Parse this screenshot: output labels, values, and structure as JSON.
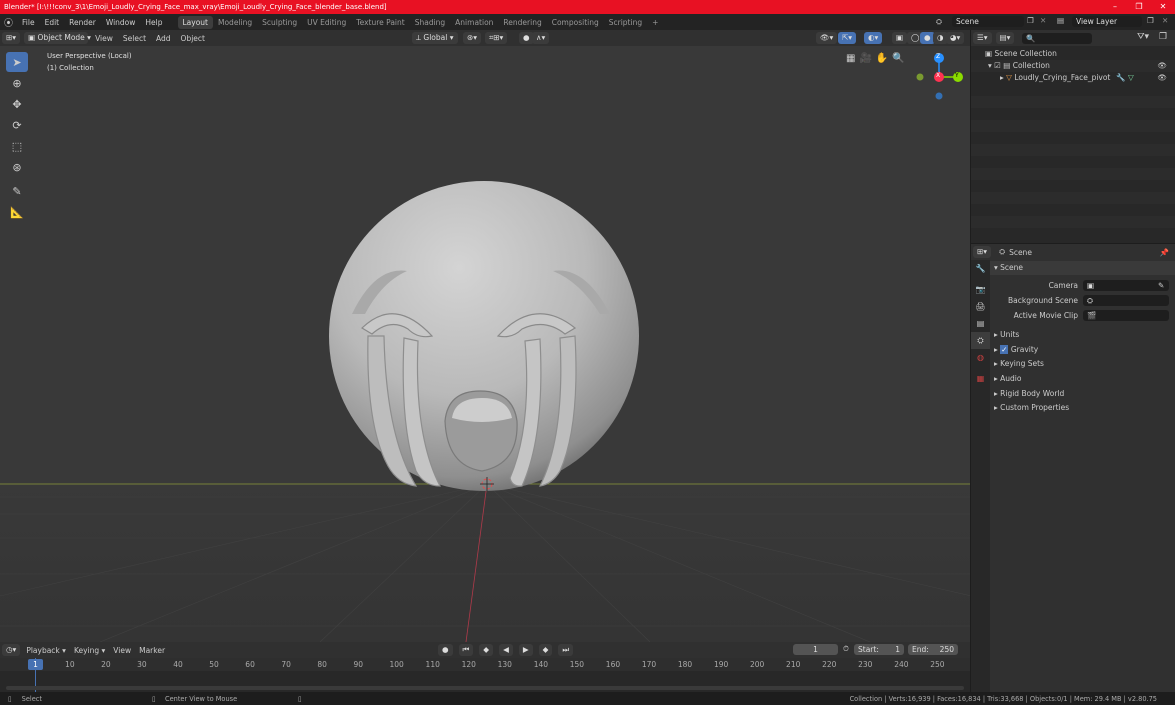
{
  "window": {
    "title": "Blender* [I:\\!!!conv_3\\1\\Emoji_Loudly_Crying_Face_max_vray\\Emoji_Loudly_Crying_Face_blender_base.blend]",
    "controls": [
      "–",
      "❐",
      "✕"
    ]
  },
  "menus": [
    "File",
    "Edit",
    "Render",
    "Window",
    "Help"
  ],
  "workspaces": [
    "Layout",
    "Modeling",
    "Sculpting",
    "UV Editing",
    "Texture Paint",
    "Shading",
    "Animation",
    "Rendering",
    "Compositing",
    "Scripting",
    "+"
  ],
  "scene_field": "Scene",
  "view_layer_field": "View Layer",
  "viewport_header": {
    "mode": "Object Mode",
    "menu": [
      "View",
      "Select",
      "Add",
      "Object"
    ],
    "orientation": "Global"
  },
  "viewport": {
    "perspective": "User Perspective (Local)",
    "collection": "(1) Collection"
  },
  "gizmo": {
    "z": "Z",
    "y": "Y",
    "x": "X"
  },
  "outliner": {
    "items": [
      {
        "label": "Scene Collection"
      },
      {
        "label": "Collection"
      },
      {
        "label": "Loudly_Crying_Face_pivot"
      }
    ]
  },
  "properties": {
    "header": "Scene",
    "panel": "Scene",
    "fields": [
      {
        "label": "Camera"
      },
      {
        "label": "Background Scene"
      },
      {
        "label": "Active Movie Clip"
      }
    ],
    "sections": [
      "Units",
      "Gravity",
      "Keying Sets",
      "Audio",
      "Rigid Body World",
      "Custom Properties"
    ]
  },
  "timeline": {
    "menu": [
      "Playback",
      "Keying",
      "View",
      "Marker"
    ],
    "current_frame": "1",
    "start_label": "Start:",
    "start": "1",
    "end_label": "End:",
    "end": "250",
    "ruler": [
      "10",
      "20",
      "30",
      "40",
      "50",
      "60",
      "70",
      "80",
      "90",
      "100",
      "110",
      "120",
      "130",
      "140",
      "150",
      "160",
      "170",
      "180",
      "190",
      "200",
      "210",
      "220",
      "230",
      "240",
      "250"
    ]
  },
  "status": {
    "select": "Select",
    "center": "Center View to Mouse",
    "stats": "Collection | Verts:16,939 | Faces:16,834 | Tris:33,668 | Objects:0/1 | Mem: 29.4 MB | v2.80.75"
  },
  "colors": {
    "accent": "#4772b3",
    "title_bar": "#e81123",
    "x_axis": "#ff3352",
    "y_axis": "#8bdc00",
    "z_axis": "#2890ff"
  }
}
